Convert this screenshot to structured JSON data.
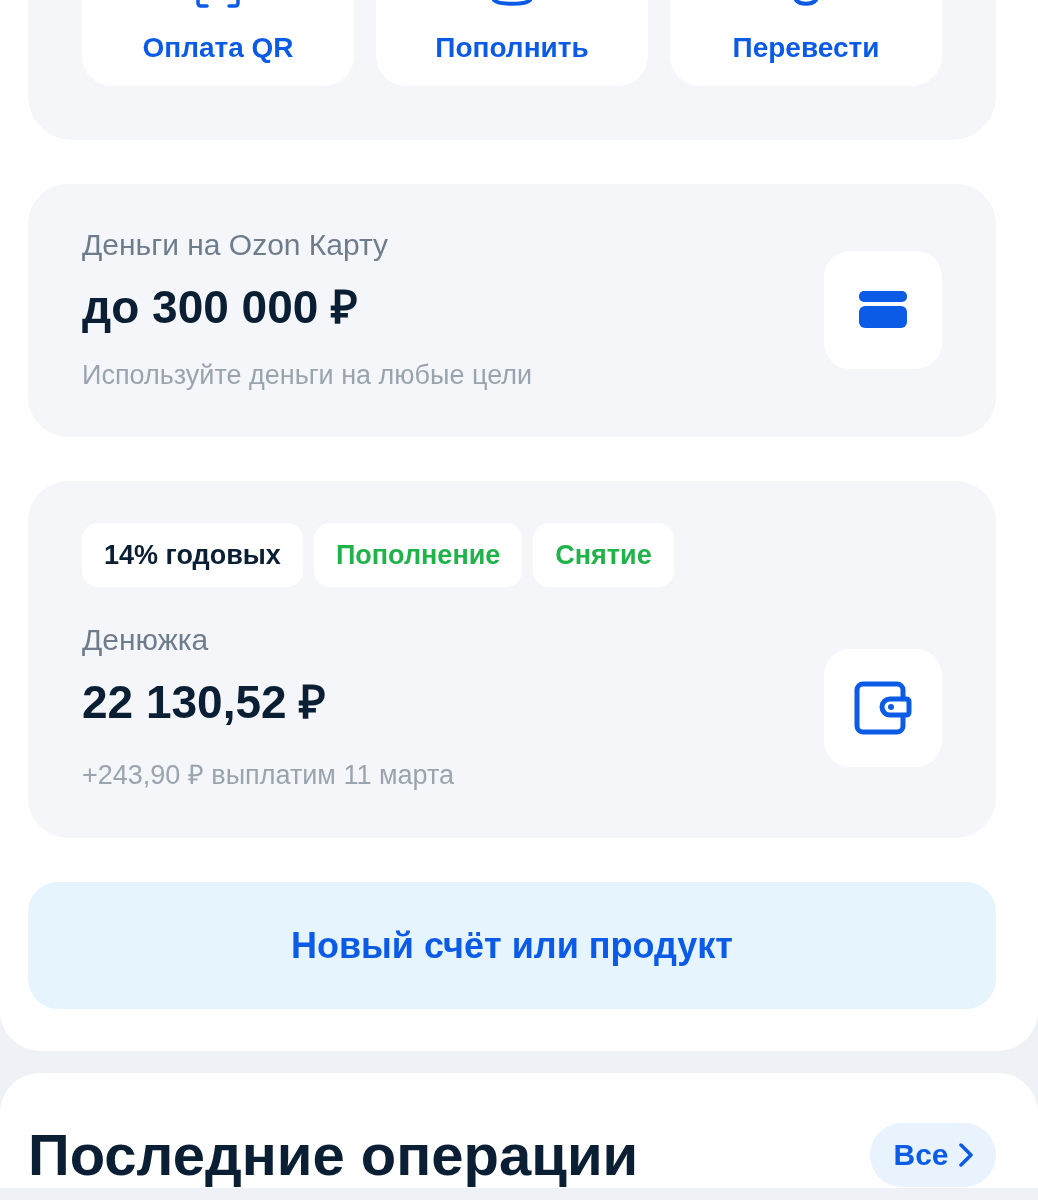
{
  "quick_actions": [
    {
      "label": "Оплата QR",
      "kind": "qr"
    },
    {
      "label": "Пополнить",
      "kind": "topup"
    },
    {
      "label": "Перевести",
      "kind": "transfer"
    }
  ],
  "products": [
    {
      "kind": "credit",
      "title": "Деньги на Ozon Карту",
      "amount": "до 300 000 ₽",
      "note": "Используйте деньги на любые цели"
    },
    {
      "kind": "savings",
      "title": "Денюжка",
      "amount": "22 130,52 ₽",
      "note": "+243,90 ₽ выплатим 11 марта",
      "tags": [
        {
          "label": "14% годовых",
          "color": "#0a1f33"
        },
        {
          "label": "Пополнение",
          "color": "#1fb34a"
        },
        {
          "label": "Снятие",
          "color": "#1fb34a"
        }
      ]
    }
  ],
  "new_product_button": "Новый счёт или продукт",
  "recent": {
    "title": "Последние операции",
    "all_button": "Все"
  }
}
